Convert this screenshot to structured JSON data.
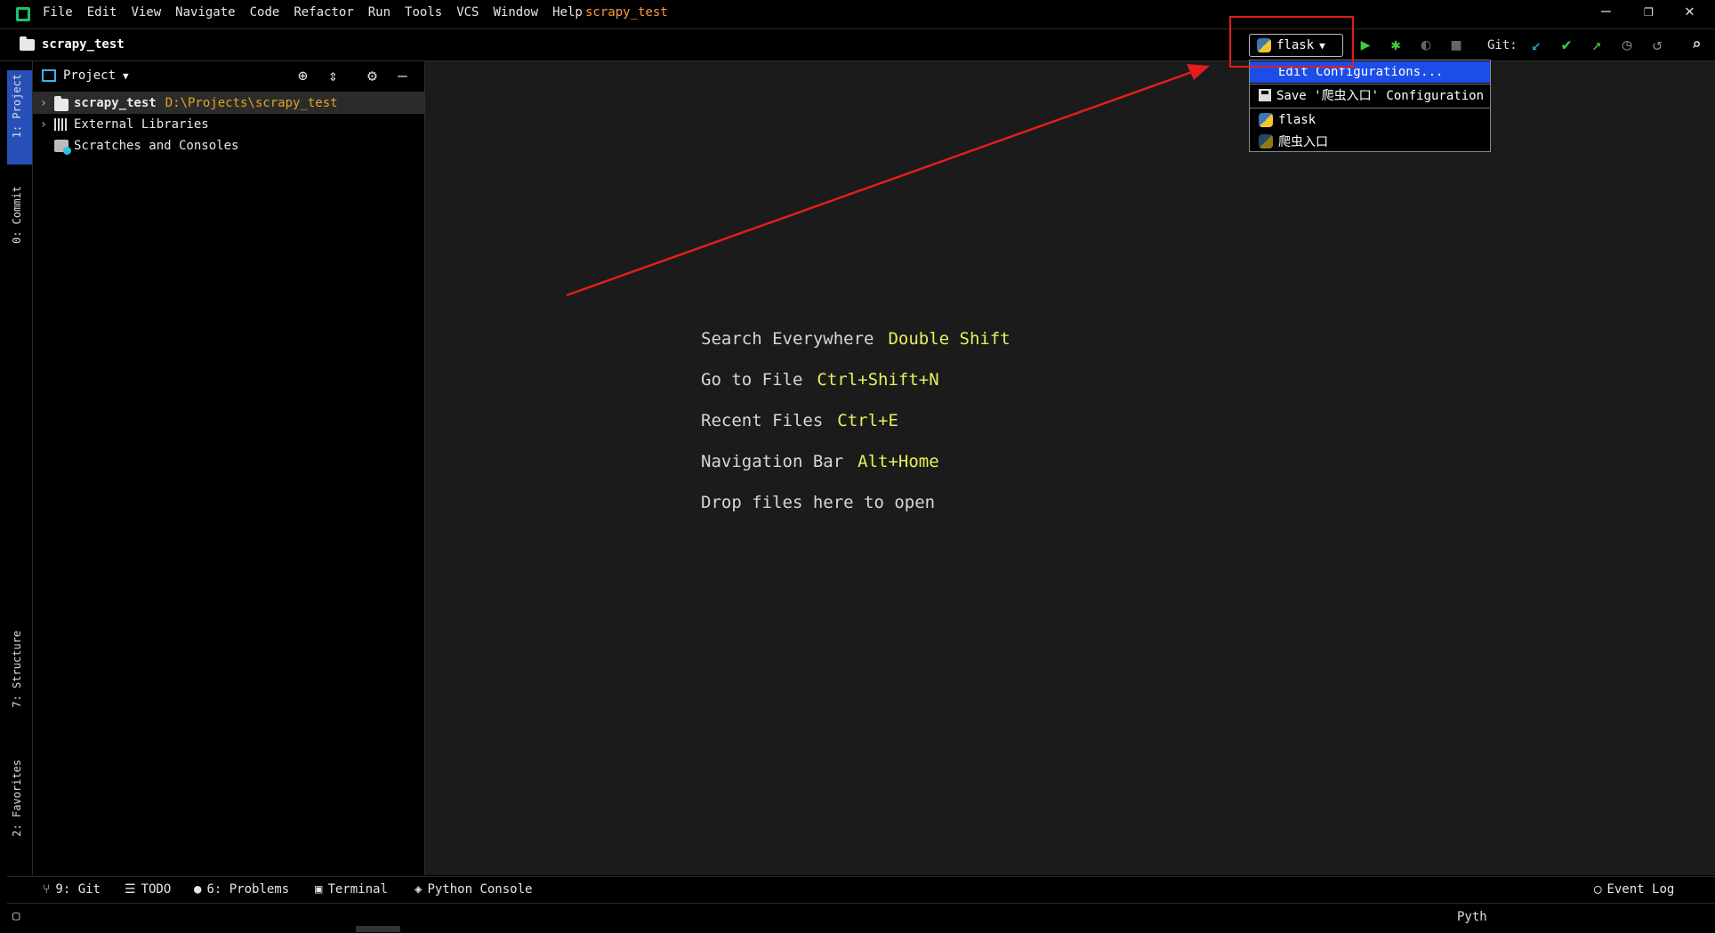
{
  "menubar": {
    "items": [
      "File",
      "Edit",
      "View",
      "Navigate",
      "Code",
      "Refactor",
      "Run",
      "Tools",
      "VCS",
      "Window",
      "Help"
    ],
    "project_title": "scrapy_test",
    "window_controls": {
      "minimize": "—",
      "restore": "❐",
      "close": "✕"
    }
  },
  "navbar": {
    "breadcrumb": "scrapy_test",
    "run_config": "flask",
    "git_label": "Git:"
  },
  "run_config_popup": {
    "items": [
      {
        "label": "Edit Configurations...",
        "selected": true
      },
      {
        "label": "Save '爬虫入口' Configuration",
        "icon": "save-icon"
      },
      {
        "label": "flask",
        "icon": "python-icon"
      },
      {
        "label": "爬虫入口",
        "icon": "python-icon"
      }
    ]
  },
  "left_strip": {
    "tabs": [
      "1: Project",
      "0: Commit",
      "7: Structure",
      "2: Favorites"
    ]
  },
  "project_panel": {
    "title": "Project",
    "tree": [
      {
        "label": "scrapy_test",
        "path": "D:\\Projects\\scrapy_test",
        "icon": "folder-icon",
        "selected": true
      },
      {
        "label": "External Libraries",
        "icon": "library-icon"
      },
      {
        "label": "Scratches and Consoles",
        "icon": "scratches-icon"
      }
    ]
  },
  "editor": {
    "hints": [
      {
        "action": "Search Everywhere",
        "shortcut": "Double Shift"
      },
      {
        "action": "Go to File",
        "shortcut": "Ctrl+Shift+N"
      },
      {
        "action": "Recent Files",
        "shortcut": "Ctrl+E"
      },
      {
        "action": "Navigation Bar",
        "shortcut": "Alt+Home"
      },
      {
        "action": "Drop files here to open",
        "shortcut": ""
      }
    ]
  },
  "bottom_bar": {
    "tabs": [
      "9: Git",
      "TODO",
      "6: Problems",
      "Terminal",
      "Python Console"
    ],
    "event_log": "Event Log"
  },
  "status_bar": {
    "right_text": "Pyth"
  },
  "colors": {
    "accent_highlight": "#e21d1d",
    "selection": "#1d4de8",
    "shortcut": "#e6f05a",
    "path": "#e4a21f"
  }
}
